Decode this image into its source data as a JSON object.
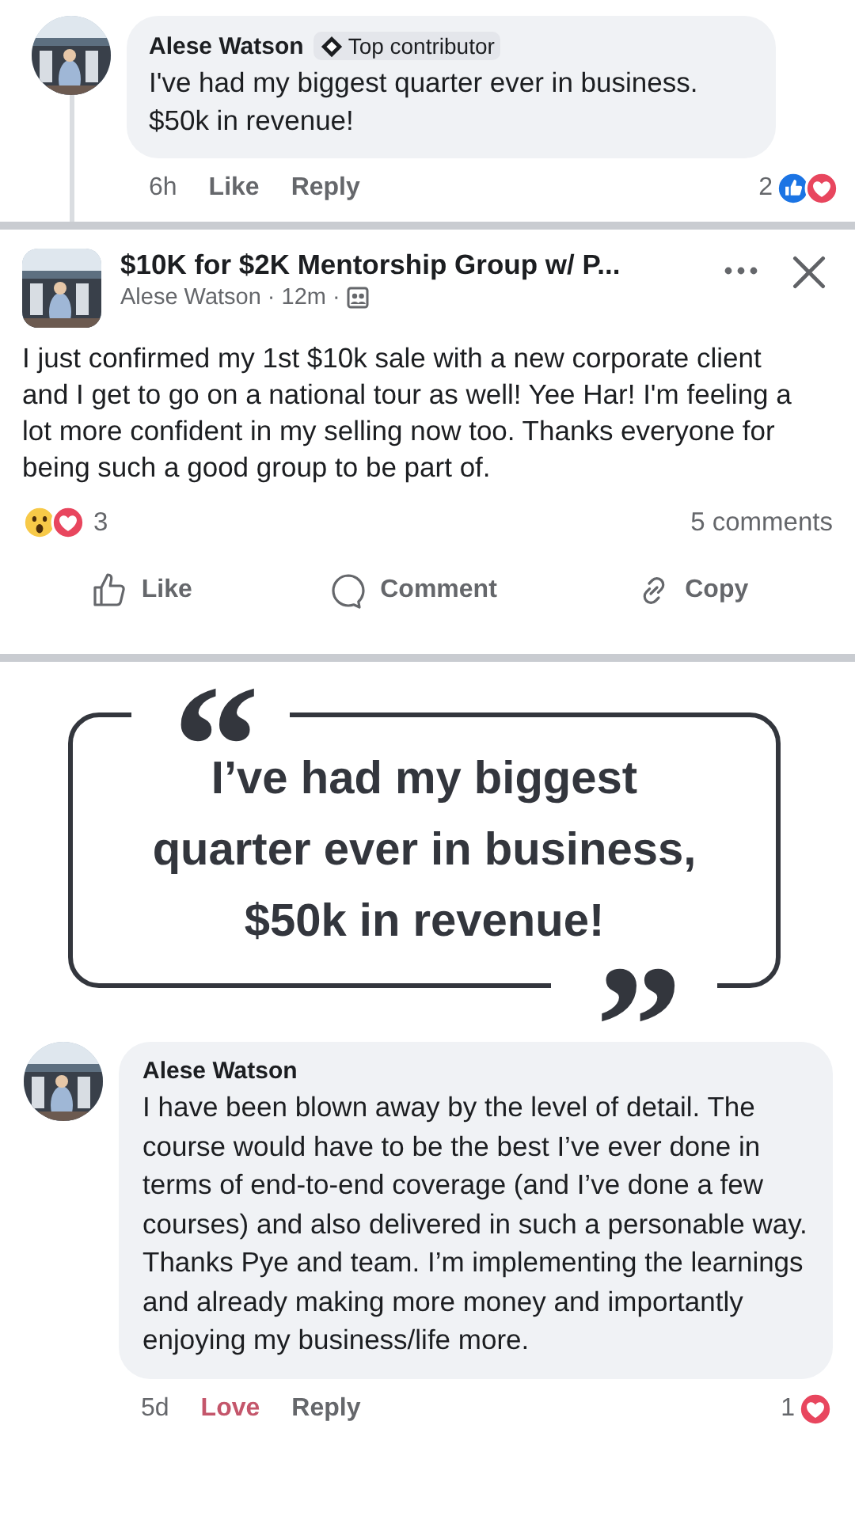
{
  "top_comment": {
    "author": "Alese Watson",
    "badge": "Top contributor",
    "text": "I've had my biggest quarter ever in business. $50k in revenue!",
    "time": "6h",
    "actions": [
      {
        "label": "Like",
        "selected": false
      },
      {
        "label": "Reply",
        "selected": false
      }
    ],
    "reaction_count": "2",
    "reactions": [
      {
        "kind": "like"
      },
      {
        "kind": "love"
      }
    ]
  },
  "post": {
    "group": "$10K for $2K Mentorship Group w/ P...",
    "author": "Alese Watson",
    "time": "12m",
    "separator": "·",
    "text": "I just confirmed my 1st $10k sale with a new corporate client and I get to go on a national tour as well!  Yee Har! I'm feeling a lot more confident in my selling now too. Thanks everyone for being such a good group to be part of.",
    "reactions": [
      {
        "kind": "wow"
      },
      {
        "kind": "love"
      }
    ],
    "reaction_count": "3",
    "comments": "5 comments",
    "actions": [
      {
        "kind": "like",
        "label": "Like"
      },
      {
        "kind": "comment",
        "label": "Comment"
      },
      {
        "kind": "copy",
        "label": "Copy"
      }
    ]
  },
  "quote": {
    "open_mark": "“",
    "close_mark": "”",
    "text": "I’ve had my biggest quarter ever in business, $50k in revenue!"
  },
  "bottom_comment": {
    "author": "Alese Watson",
    "text": "I have been blown away by the level of detail. The course would have to be the best I’ve ever done in terms of end-to-end coverage (and I’ve done a few courses) and also delivered in such a personable way. Thanks Pye and team. I’m implementing the learnings and already making more money and importantly enjoying my business/life  more.",
    "time": "5d",
    "actions": [
      {
        "label": "Love",
        "selected": true
      },
      {
        "label": "Reply",
        "selected": false
      }
    ],
    "reaction_count": "1",
    "reactions": [
      {
        "kind": "love"
      }
    ]
  }
}
